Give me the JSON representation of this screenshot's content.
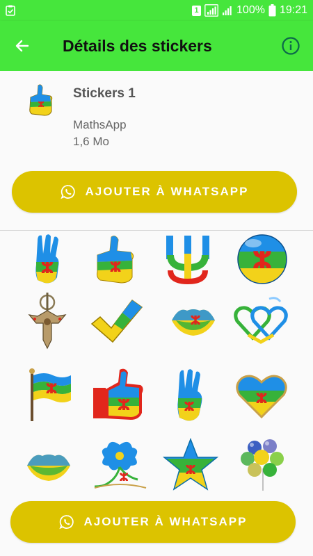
{
  "status_bar": {
    "sim_slot": "1",
    "battery": "100%",
    "time": "19:21"
  },
  "app_bar": {
    "title": "Détails des stickers",
    "back_icon": "arrow-left-icon",
    "info_icon": "info-icon"
  },
  "pack": {
    "name": "Stickers 1",
    "publisher": "MathsApp",
    "size": "1,6 Mo"
  },
  "add_button": {
    "label": "AJOUTER À WHATSAPP",
    "icon": "whatsapp-icon"
  },
  "stickers": [
    {
      "name": "three-fingers-amazigh-flag"
    },
    {
      "name": "thumbs-up-amazigh-flag"
    },
    {
      "name": "yaz-symbol"
    },
    {
      "name": "amazigh-flag-ball"
    },
    {
      "name": "tuareg-cross-pendant"
    },
    {
      "name": "checkmark-amazigh-flag"
    },
    {
      "name": "lips-yaz"
    },
    {
      "name": "double-hearts"
    },
    {
      "name": "waving-amazigh-flag"
    },
    {
      "name": "thumbs-up-flag-big"
    },
    {
      "name": "three-fingers-hand"
    },
    {
      "name": "heart-amazigh-flag"
    },
    {
      "name": "kiss-lips-flag"
    },
    {
      "name": "floral-yaz"
    },
    {
      "name": "star-amazigh-flag"
    },
    {
      "name": "balloons"
    }
  ],
  "colors": {
    "accent_green": "#46e63c",
    "button_yellow": "#dcc300",
    "flag_blue": "#1f8fe6",
    "flag_green": "#37b23a",
    "flag_yellow": "#f2d21a",
    "flag_red": "#e1261c"
  }
}
